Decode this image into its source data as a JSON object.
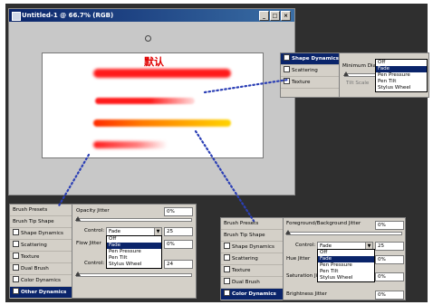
{
  "document_window": {
    "title": "Untitled-1 @ 66.7% (RGB)",
    "minimize": "_",
    "maximize": "□",
    "close": "×",
    "canvas_text": "默认"
  },
  "top_panel": {
    "active_item": "Shape Dynamics",
    "items": [
      "Scattering",
      "Texture"
    ],
    "control_label": "Control:",
    "min_label": "Minimum Diam",
    "tilt_label": "Tilt Scale",
    "options": [
      "Off",
      "Fade",
      "Pen Pressure",
      "Pen Tilt",
      "Stylus Wheel"
    ],
    "highlighted": "Fade"
  },
  "other_panel": {
    "items": [
      "Brush Presets",
      "Brush Tip Shape",
      "Shape Dynamics",
      "Scattering",
      "Texture",
      "Dual Brush",
      "Color Dynamics",
      "Other Dynamics"
    ],
    "checkbox_items": [
      "Shape Dynamics",
      "Scattering",
      "Texture",
      "Dual Brush",
      "Color Dynamics"
    ],
    "active_item": "Other Dynamics",
    "opacity_label": "Opacity Jitter",
    "opacity_value": "0%",
    "control_label": "Control:",
    "control_value": "Fade",
    "fade_steps": "25",
    "flow_label": "Flow Jitter",
    "flow_value": "0%",
    "control2_value": "24",
    "options": [
      "Off",
      "Fade",
      "Pen Pressure",
      "Pen Tilt",
      "Stylus Wheel"
    ],
    "highlighted": "Fade"
  },
  "color_panel": {
    "items": [
      "Brush Presets",
      "Brush Tip Shape",
      "Shape Dynamics",
      "Scattering",
      "Texture",
      "Dual Brush",
      "Color Dynamics"
    ],
    "checkbox_items": [
      "Shape Dynamics",
      "Scattering",
      "Texture",
      "Dual Brush"
    ],
    "active_item": "Color Dynamics",
    "fgbg_label": "Foreground/Background Jitter",
    "fgbg_value": "0%",
    "control_label": "Control:",
    "control_value": "Fade",
    "fade_steps": "25",
    "hue_label": "Hue Jitter",
    "hue_value": "0%",
    "sat_label": "Saturation Ji",
    "sat_value": "0%",
    "bright_label": "Brightness Jitter",
    "bright_value": "0%",
    "options": [
      "Off",
      "Fade",
      "Pen Pressure",
      "Pen Tilt",
      "Stylus Wheel"
    ],
    "highlighted": "Fade"
  },
  "colors": {
    "backdrop": "#2f2f2f",
    "selection": "#0a246a",
    "dot_blue": "#2b3fb5",
    "stroke_red": "#ff1a1a",
    "stroke_yellow": "#ffd400"
  }
}
